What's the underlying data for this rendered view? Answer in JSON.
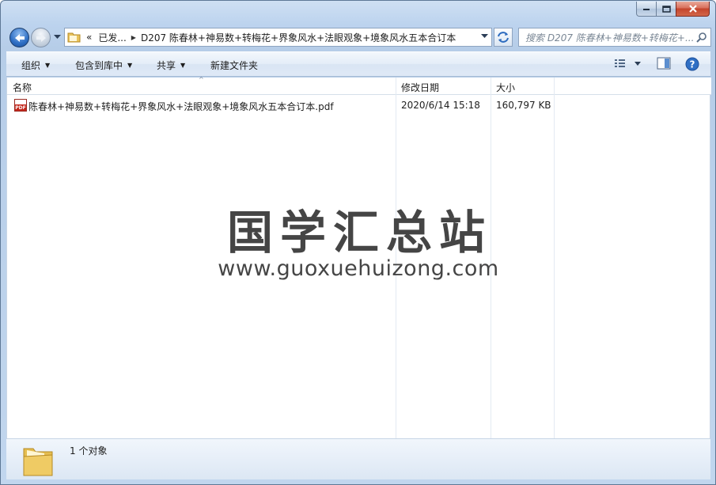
{
  "window": {
    "caption_buttons": [
      "minimize",
      "maximize",
      "close"
    ]
  },
  "nav": {
    "breadcrumb_overflow": "«",
    "breadcrumb_parent": "已发...",
    "breadcrumb_current": "D207 陈春林+神易数+转梅花+界象风水+法眼观象+境象风水五本合订本",
    "search_placeholder": "搜索 D207 陈春林+神易数+转梅花+..."
  },
  "toolbar": {
    "organize": "组织",
    "include_in_library": "包含到库中",
    "share": "共享",
    "new_folder": "新建文件夹"
  },
  "columns": {
    "name": "名称",
    "modified": "修改日期",
    "size": "大小"
  },
  "files": [
    {
      "name": "陈春林+神易数+转梅花+界象风水+法眼观象+境象风水五本合订本.pdf",
      "modified": "2020/6/14 15:18",
      "size": "160,797 KB",
      "icon": "pdf-icon",
      "icon_label": "PDF"
    }
  ],
  "watermark": {
    "title": "国学汇总站",
    "url": "www.guoxuehuizong.com"
  },
  "status": {
    "count": "1 个对象"
  },
  "colors": {
    "frame": "#bcd3ee",
    "close": "#c4442c",
    "watermark": "#454545"
  }
}
